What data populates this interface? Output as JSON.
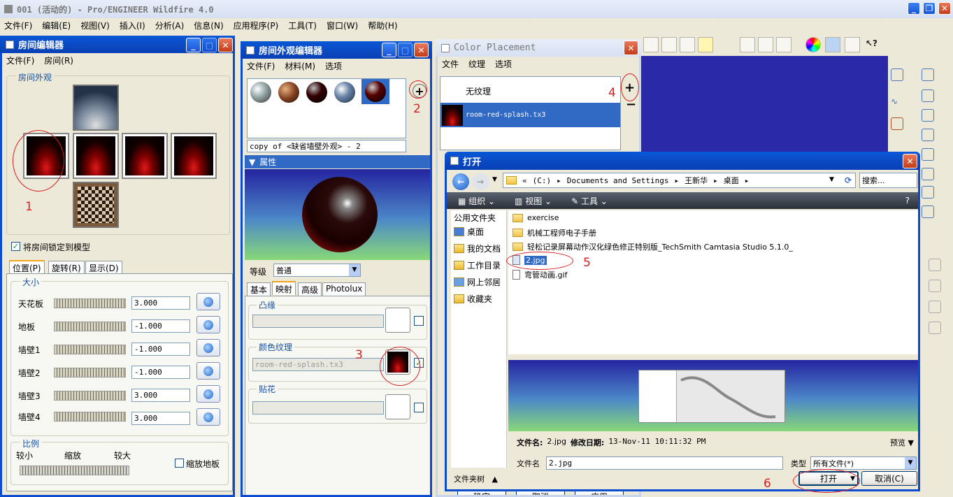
{
  "main": {
    "title": "001 (活动的) - Pro/ENGINEER Wildfire 4.0",
    "menu": [
      "文件(F)",
      "编辑(E)",
      "视图(V)",
      "插入(I)",
      "分析(A)",
      "信息(N)",
      "应用程序(P)",
      "工具(T)",
      "窗口(W)",
      "帮助(H)"
    ]
  },
  "room_editor": {
    "title": "房间编辑器",
    "menu": [
      "文件(F)",
      "房间(R)"
    ],
    "appearance_label": "房间外观",
    "lock_label": "将房间锁定到模型",
    "tabs": [
      "位置(P)",
      "旋转(R)",
      "显示(D)"
    ],
    "size_label": "大小",
    "rows": [
      {
        "label": "天花板",
        "value": "3.000"
      },
      {
        "label": "地板",
        "value": "-1.000"
      },
      {
        "label": "墙壁1",
        "value": "-1.000"
      },
      {
        "label": "墙壁2",
        "value": "-1.000"
      },
      {
        "label": "墙壁3",
        "value": "3.000"
      },
      {
        "label": "墙壁4",
        "value": "3.000"
      }
    ],
    "scale_label": "比例",
    "scale_smaller": "较小",
    "scale_zoom": "缩放",
    "scale_larger": "较大",
    "scale_floor": "缩放地板"
  },
  "appearance_editor": {
    "title": "房间外观编辑器",
    "menu": [
      "文件(F)",
      "材料(M)",
      "选项"
    ],
    "name_value": "copy of <缺省墙壁外观> - 2",
    "properties": "属性",
    "level_label": "等级",
    "level_value": "普通",
    "tabs": [
      "基本",
      "映射",
      "高级",
      "Photolux"
    ],
    "bump_label": "凸缘",
    "color_texture_label": "颜色纹理",
    "texture_value": "room-red-splash.tx3",
    "decal_label": "贴花"
  },
  "color_placement": {
    "title": "Color Placement",
    "menu": [
      "文件",
      "纹理",
      "选项"
    ],
    "none_label": "无纹理",
    "texture_item": "room-red-splash.tx3",
    "bottom_buttons": [
      "确定",
      "取消",
      "应用"
    ]
  },
  "open_dialog": {
    "title": "打开",
    "path": [
      "«",
      "(C:)",
      "Documents and Settings",
      "王新华",
      "桌面"
    ],
    "search_placeholder": "搜索...",
    "toolbar": [
      "组织",
      "视图",
      "工具"
    ],
    "nav": [
      "公用文件夹",
      "桌面",
      "我的文档",
      "工作目录",
      "网上邻居",
      "收藏夹"
    ],
    "files": [
      {
        "name": "exercise",
        "type": "folder"
      },
      {
        "name": "机械工程师电子手册",
        "type": "folder"
      },
      {
        "name": "轻松记录屏幕动作汉化绿色修正特别版_TechSmith Camtasia Studio 5.1.0_",
        "type": "folder"
      },
      {
        "name": "2.jpg",
        "type": "image"
      },
      {
        "name": "弯管动画.gif",
        "type": "doc"
      }
    ],
    "info_name_label": "文件名:",
    "info_name_value": "2.jpg",
    "info_date_label": "修改日期:",
    "info_date_value": "13-Nov-11 10:11:32 PM",
    "preview_label": "预览",
    "filename_label": "文件名",
    "filename_value": "2.jpg",
    "type_label": "类型",
    "type_value": "所有文件(*)",
    "folder_tree": "文件夹树",
    "open_button": "打开",
    "cancel_button": "取消(C)"
  },
  "annotations": [
    "1",
    "2",
    "3",
    "4",
    "5",
    "6"
  ],
  "colors": {
    "accent": "#0b4bd0",
    "annotation": "#d82020",
    "selection": "#316ac5"
  }
}
